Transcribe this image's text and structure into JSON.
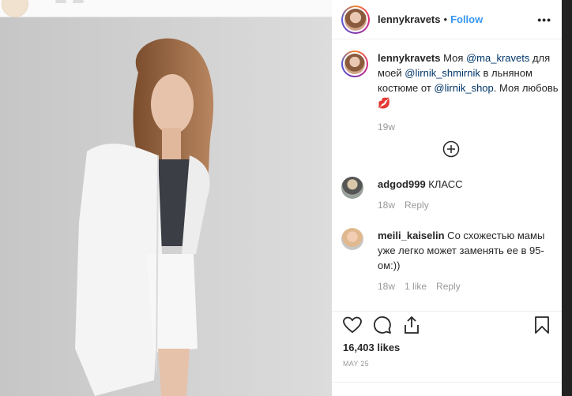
{
  "post": {
    "username": "lennykravets",
    "separator": "•",
    "follow_label": "Follow",
    "more_label": "•••"
  },
  "caption": {
    "username": "lennykravets",
    "text_1": " Моя ",
    "mention_1": "@ma_kravets",
    "text_2": " для моей ",
    "mention_2": "@lirnik_shmirnik",
    "text_3": " в льняном костюме от ",
    "mention_3": "@lirnik_shop",
    "text_4": ". Моя любовь",
    "emoji": "💋",
    "age": "19w"
  },
  "comments": [
    {
      "username": "adgod999",
      "text": " КЛАСС",
      "age": "18w",
      "likes": "",
      "reply": "Reply"
    },
    {
      "username": "meili_kaiselin",
      "text": " Со схожестью мамы уже легко может заменять ее в 95-ом:))",
      "age": "18w",
      "likes": "1 like",
      "reply": "Reply"
    }
  ],
  "stats": {
    "likes": "16,403 likes",
    "date": "MAY 25"
  },
  "icons": [
    "heart-icon",
    "comment-icon",
    "share-icon",
    "bookmark-icon",
    "more-comments-icon",
    "options-icon"
  ],
  "colors": {
    "link": "#3897f0",
    "mention": "#003569",
    "muted": "#999999"
  }
}
